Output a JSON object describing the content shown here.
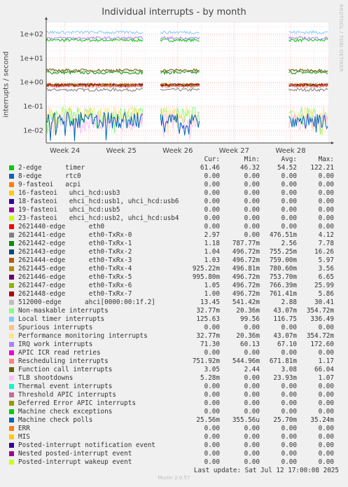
{
  "title": "Individual interrupts - by month",
  "side_text": "RRDTOOL / TOBI OETIKER",
  "footer": "Munin 2.0.57",
  "last_update": "Last update: Sat Jul 12 17:00:08 2025",
  "columns": [
    "Cur:",
    "Min:",
    "Avg:",
    "Max:"
  ],
  "chart_data": {
    "type": "line",
    "ylabel": "interrupts / second",
    "yscale": "log",
    "ylim": [
      0.003,
      300
    ],
    "yticks": [
      {
        "v": 100,
        "label": "1e+02"
      },
      {
        "v": 10,
        "label": "1e+01"
      },
      {
        "v": 1,
        "label": "1e+00"
      },
      {
        "v": 0.1,
        "label": "1e-01"
      },
      {
        "v": 0.01,
        "label": "1e-02"
      }
    ],
    "xticks": [
      "Week 24",
      "Week 25",
      "Week 26",
      "Week 27",
      "Week 28"
    ],
    "data_segments": [
      [
        0.0,
        0.345
      ],
      [
        0.405,
        0.545
      ],
      [
        0.86,
        1.0
      ]
    ],
    "series": [
      {
        "name": "2-edge      timer",
        "color": "#00cc00",
        "cur": "61.46",
        "min": "46.32",
        "avg": "54.52",
        "max": "122.21",
        "level": 55
      },
      {
        "name": "8-edge      rtc0",
        "color": "#0066b3",
        "cur": "0.00",
        "min": "0.00",
        "avg": "0.00",
        "max": "0.00",
        "level": null
      },
      {
        "name": "9-fasteoi   acpi",
        "color": "#ff8000",
        "cur": "0.00",
        "min": "0.00",
        "avg": "0.00",
        "max": "0.00",
        "level": null
      },
      {
        "name": "16-fasteoi   uhci_hcd:usb3",
        "color": "#ffcc00",
        "cur": "0.00",
        "min": "0.00",
        "avg": "0.00",
        "max": "0.00",
        "level": null
      },
      {
        "name": "18-fasteoi   ehci_hcd:usb1, uhci_hcd:usb6",
        "color": "#330099",
        "cur": "0.00",
        "min": "0.00",
        "avg": "0.00",
        "max": "0.00",
        "level": null
      },
      {
        "name": "19-fasteoi   uhci_hcd:usb5",
        "color": "#990099",
        "cur": "0.00",
        "min": "0.00",
        "avg": "0.00",
        "max": "0.00",
        "level": null
      },
      {
        "name": "23-fasteoi   ehci_hcd:usb2, uhci_hcd:usb4",
        "color": "#ccff00",
        "cur": "0.00",
        "min": "0.00",
        "avg": "0.00",
        "max": "0.00",
        "level": null
      },
      {
        "name": "2621440-edge      eth0",
        "color": "#ff0000",
        "cur": "0.00",
        "min": "0.00",
        "avg": "0.00",
        "max": "0.00",
        "level": null
      },
      {
        "name": "2621441-edge      eth0-TxRx-0",
        "color": "#808080",
        "cur": "2.97",
        "min": "0.00",
        "avg": "476.51m",
        "max": "4.12",
        "level": 0.48
      },
      {
        "name": "2621442-edge      eth0-TxRx-1",
        "color": "#008f00",
        "cur": "1.18",
        "min": "787.77m",
        "avg": "2.56",
        "max": "7.78",
        "level": 2.5
      },
      {
        "name": "2621443-edge      eth0-TxRx-2",
        "color": "#00487d",
        "cur": "1.04",
        "min": "496.72m",
        "avg": "755.25m",
        "max": "16.26",
        "level": 0.76
      },
      {
        "name": "2621444-edge      eth0-TxRx-3",
        "color": "#b35a00",
        "cur": "1.03",
        "min": "496.72m",
        "avg": "759.00m",
        "max": "5.97",
        "level": 0.76
      },
      {
        "name": "2621445-edge      eth0-TxRx-4",
        "color": "#b38f00",
        "cur": "925.22m",
        "min": "496.81m",
        "avg": "780.60m",
        "max": "3.56",
        "level": 0.78
      },
      {
        "name": "2621446-edge      eth0-TxRx-5",
        "color": "#6b006b",
        "cur": "995.80m",
        "min": "496.72m",
        "avg": "753.70m",
        "max": "6.65",
        "level": 0.75
      },
      {
        "name": "2621447-edge      eth0-TxRx-6",
        "color": "#8fb300",
        "cur": "1.05",
        "min": "496.72m",
        "avg": "766.39m",
        "max": "25.99",
        "level": 0.77
      },
      {
        "name": "2621448-edge      eth0-TxRx-7",
        "color": "#b30000",
        "cur": "1.00",
        "min": "496.72m",
        "avg": "761.41m",
        "max": "5.86",
        "level": 0.76
      },
      {
        "name": "512000-edge      ahci[0000:00:1f.2]",
        "color": "#bebebe",
        "cur": "13.45",
        "min": "541.42m",
        "avg": "2.88",
        "max": "30.41",
        "level": 2.9
      },
      {
        "name": "Non-maskable interrupts",
        "color": "#80ff80",
        "cur": "32.77m",
        "min": "20.36m",
        "avg": "43.07m",
        "max": "354.72m",
        "level": 0.043
      },
      {
        "name": "Local timer interrupts",
        "color": "#80c9ff",
        "cur": "125.63",
        "min": "99.56",
        "avg": "116.75",
        "max": "336.49",
        "level": 117
      },
      {
        "name": "Spurious interrupts",
        "color": "#ffc080",
        "cur": "0.00",
        "min": "0.00",
        "avg": "0.00",
        "max": "0.00",
        "level": null
      },
      {
        "name": "Performance monitoring interrupts",
        "color": "#ffe680",
        "cur": "32.77m",
        "min": "20.36m",
        "avg": "43.07m",
        "max": "354.72m",
        "level": 0.043
      },
      {
        "name": "IRQ work interrupts",
        "color": "#aa80ff",
        "cur": "71.30",
        "min": "60.13",
        "avg": "67.10",
        "max": "172.60",
        "level": 67
      },
      {
        "name": "APIC ICR read retries",
        "color": "#ee00cc",
        "cur": "0.00",
        "min": "0.00",
        "avg": "0.00",
        "max": "0.00",
        "level": null
      },
      {
        "name": "Rescheduling interrupts",
        "color": "#ff8080",
        "cur": "751.92m",
        "min": "544.96m",
        "avg": "671.81m",
        "max": "1.17",
        "level": 0.67
      },
      {
        "name": "Function call interrupts",
        "color": "#666600",
        "cur": "3.05",
        "min": "2.44",
        "avg": "3.08",
        "max": "66.04",
        "level": 3.1
      },
      {
        "name": "TLB shootdowns",
        "color": "#ffbfff",
        "cur": "5.28m",
        "min": "0.00",
        "avg": "23.93m",
        "max": "1.07",
        "level": 0.024
      },
      {
        "name": "Thermal event interrupts",
        "color": "#00ffcc",
        "cur": "0.00",
        "min": "0.00",
        "avg": "0.00",
        "max": "0.00",
        "level": null
      },
      {
        "name": "Threshold APIC interrupts",
        "color": "#cc6699",
        "cur": "0.00",
        "min": "0.00",
        "avg": "0.00",
        "max": "0.00",
        "level": null
      },
      {
        "name": "Deferred Error APIC interrupts",
        "color": "#999900",
        "cur": "0.00",
        "min": "0.00",
        "avg": "0.00",
        "max": "0.00",
        "level": null
      },
      {
        "name": "Machine check exceptions",
        "color": "#00cc00",
        "cur": "0.00",
        "min": "0.00",
        "avg": "0.00",
        "max": "0.00",
        "level": null
      },
      {
        "name": "Machine check polls",
        "color": "#0066b3",
        "cur": "25.56m",
        "min": "355.56u",
        "avg": "25.70m",
        "max": "35.24m",
        "level": 0.0257
      },
      {
        "name": "ERR",
        "color": "#ff8000",
        "cur": "0.00",
        "min": "0.00",
        "avg": "0.00",
        "max": "0.00",
        "level": null
      },
      {
        "name": "MIS",
        "color": "#ffcc00",
        "cur": "0.00",
        "min": "0.00",
        "avg": "0.00",
        "max": "0.00",
        "level": null
      },
      {
        "name": "Posted-interrupt notification event",
        "color": "#330099",
        "cur": "0.00",
        "min": "0.00",
        "avg": "0.00",
        "max": "0.00",
        "level": null
      },
      {
        "name": "Nested posted-interrupt event",
        "color": "#990099",
        "cur": "0.00",
        "min": "0.00",
        "avg": "0.00",
        "max": "0.00",
        "level": null
      },
      {
        "name": "Posted-interrupt wakeup event",
        "color": "#ccff00",
        "cur": "0.00",
        "min": "0.00",
        "avg": "0.00",
        "max": "0.00",
        "level": null
      }
    ]
  }
}
